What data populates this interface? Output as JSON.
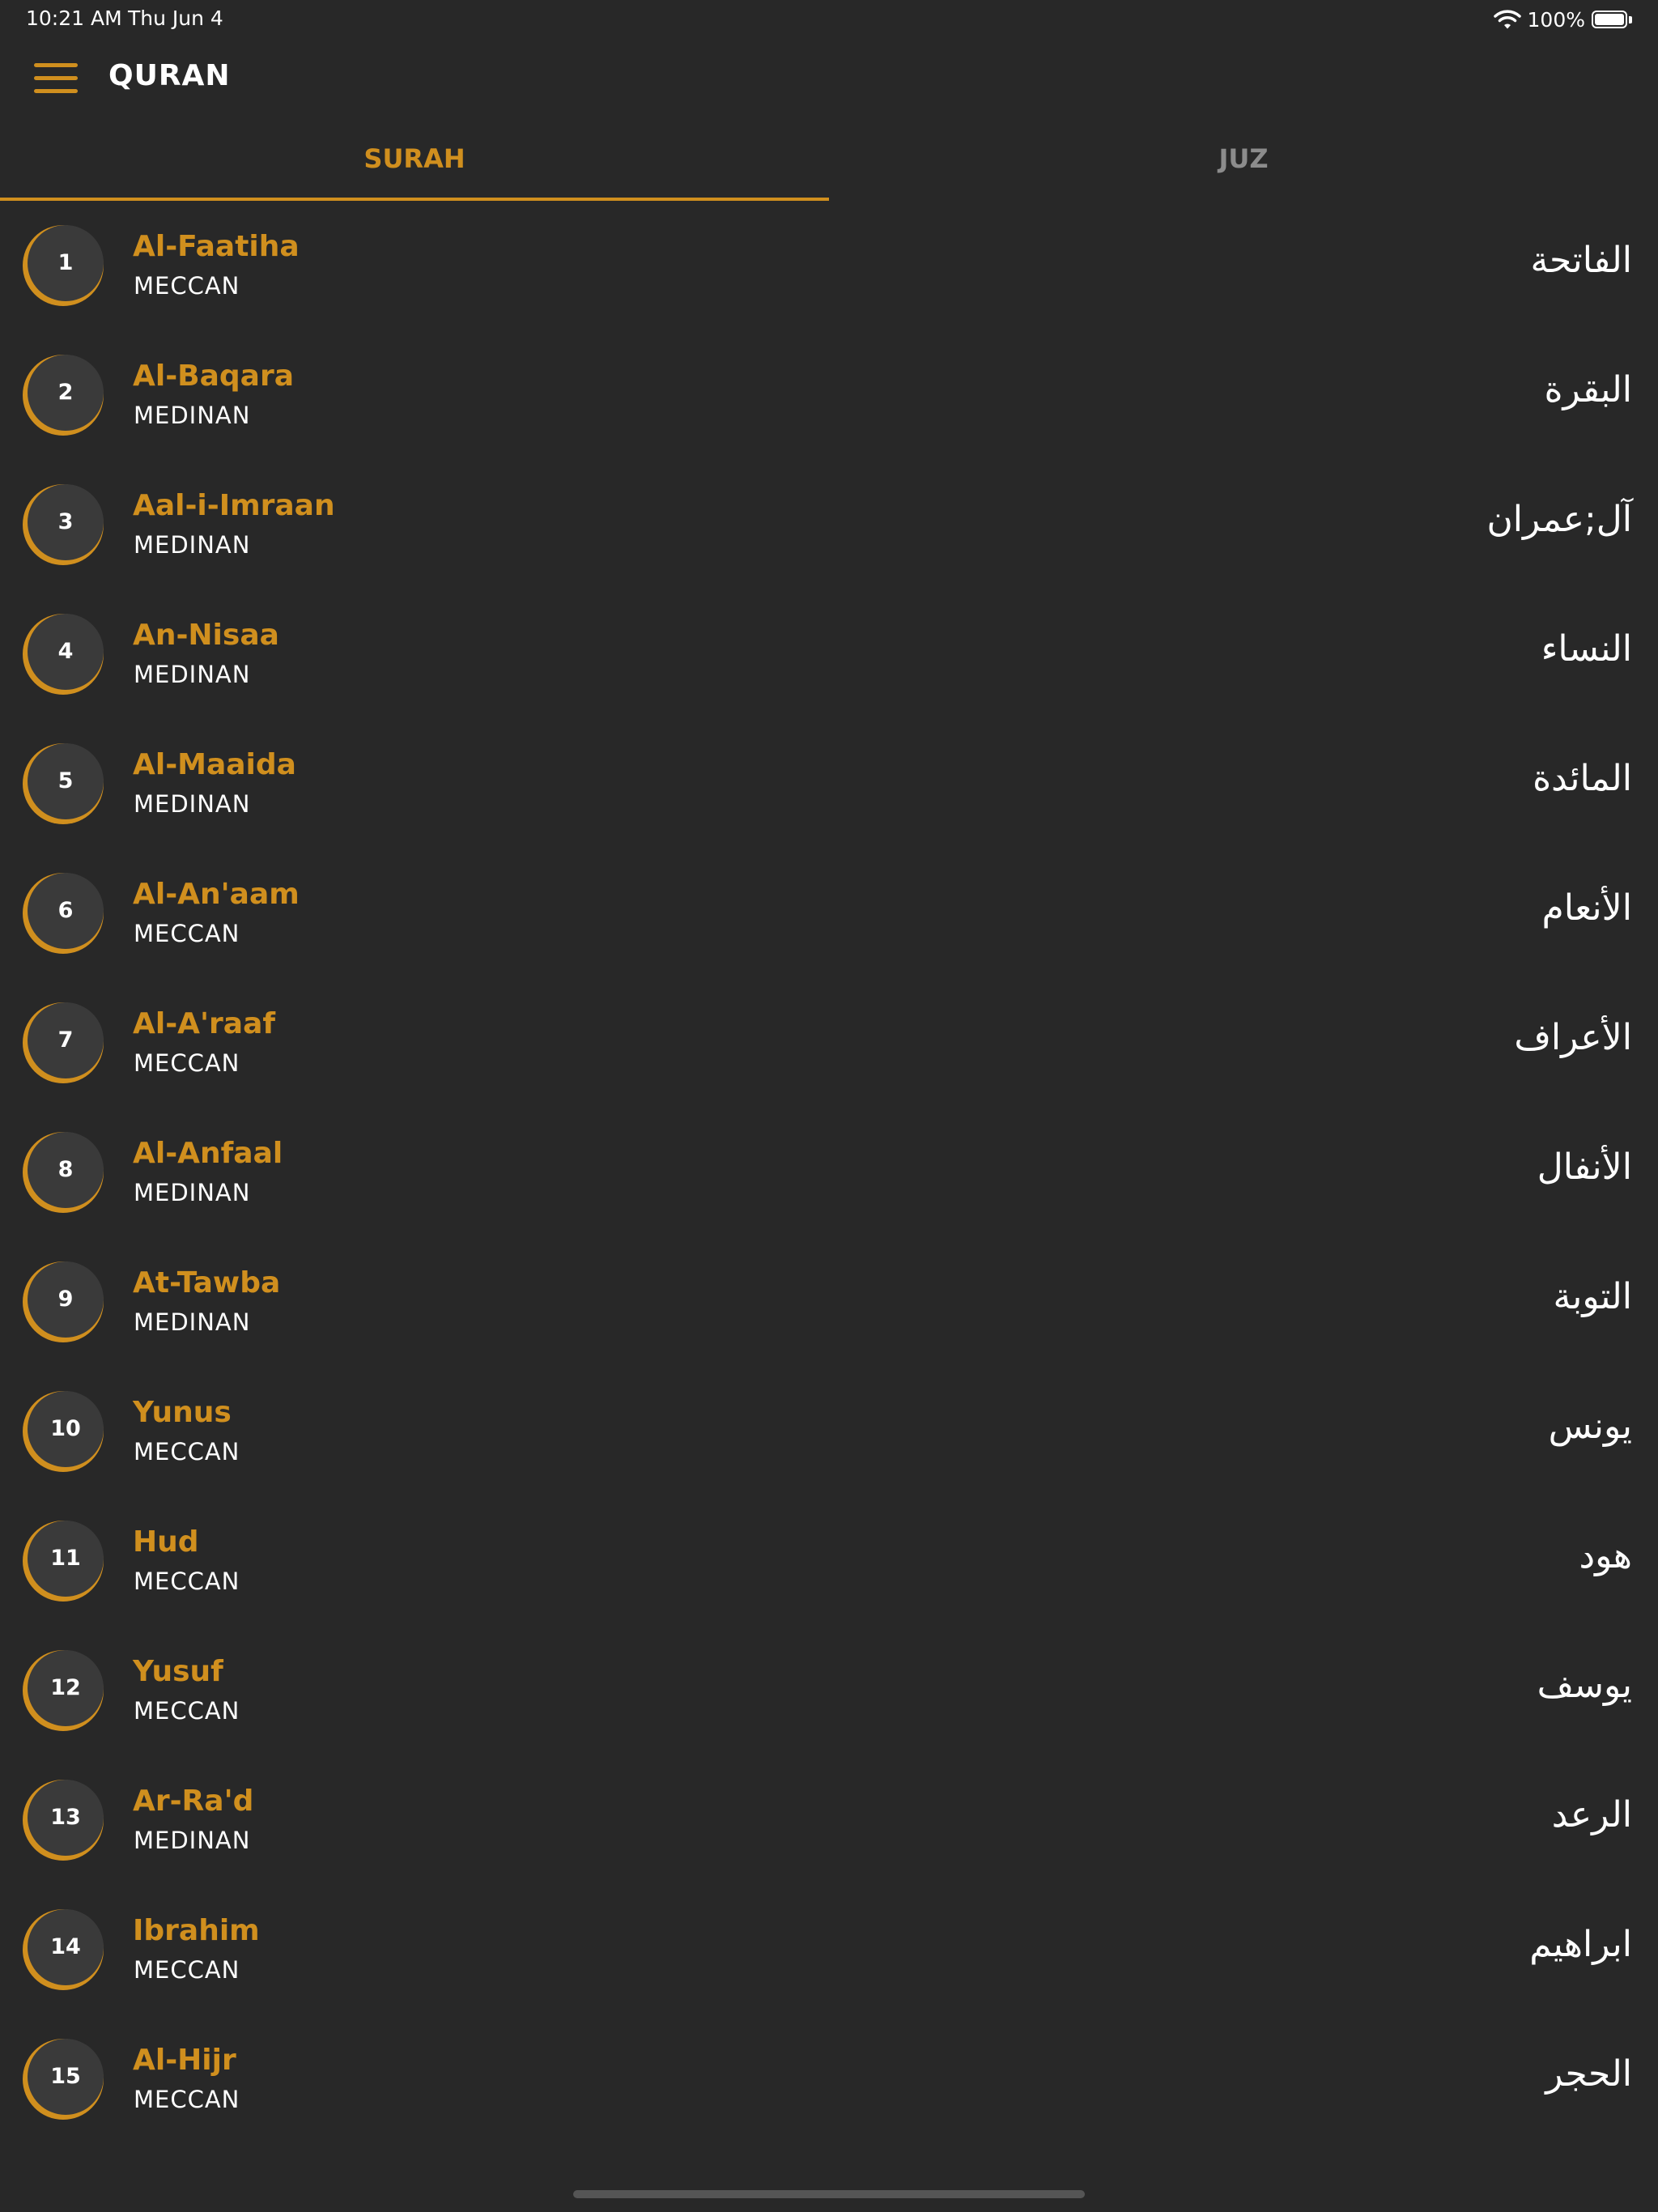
{
  "status_bar": {
    "time": "10:21 AM",
    "date": "Thu Jun 4",
    "battery": "100%",
    "icons": [
      "wifi-icon",
      "battery-icon"
    ]
  },
  "app_bar": {
    "title": "QURAN",
    "menu_icon": "hamburger-menu-icon"
  },
  "tabs": [
    {
      "label": "SURAH",
      "selected": true
    },
    {
      "label": "JUZ",
      "selected": false
    }
  ],
  "surahs": [
    {
      "number": "1",
      "name": "Al-Faatiha",
      "type": "MECCAN",
      "arabic": "الفاتحة"
    },
    {
      "number": "2",
      "name": "Al-Baqara",
      "type": "MEDINAN",
      "arabic": "البقرة"
    },
    {
      "number": "3",
      "name": "Aal-i-Imraan",
      "type": "MEDINAN",
      "arabic": "آل;عمران"
    },
    {
      "number": "4",
      "name": "An-Nisaa",
      "type": "MEDINAN",
      "arabic": "النساء"
    },
    {
      "number": "5",
      "name": "Al-Maaida",
      "type": "MEDINAN",
      "arabic": "المائدة"
    },
    {
      "number": "6",
      "name": "Al-An'aam",
      "type": "MECCAN",
      "arabic": "الأنعام"
    },
    {
      "number": "7",
      "name": "Al-A'raaf",
      "type": "MECCAN",
      "arabic": "الأعراف"
    },
    {
      "number": "8",
      "name": "Al-Anfaal",
      "type": "MEDINAN",
      "arabic": "الأنفال"
    },
    {
      "number": "9",
      "name": "At-Tawba",
      "type": "MEDINAN",
      "arabic": "التوبة"
    },
    {
      "number": "10",
      "name": "Yunus",
      "type": "MECCAN",
      "arabic": "يونس"
    },
    {
      "number": "11",
      "name": "Hud",
      "type": "MECCAN",
      "arabic": "هود"
    },
    {
      "number": "12",
      "name": "Yusuf",
      "type": "MECCAN",
      "arabic": "يوسف"
    },
    {
      "number": "13",
      "name": "Ar-Ra'd",
      "type": "MEDINAN",
      "arabic": "الرعد"
    },
    {
      "number": "14",
      "name": "Ibrahim",
      "type": "MECCAN",
      "arabic": "ابراهيم"
    },
    {
      "number": "15",
      "name": "Al-Hijr",
      "type": "MECCAN",
      "arabic": "الحجر"
    }
  ],
  "colors": {
    "background": "#282828",
    "accent": "#d08f1e",
    "badge": "#3a3a3a",
    "inactive_tab": "#8c8c8c",
    "text": "#ffffff"
  }
}
